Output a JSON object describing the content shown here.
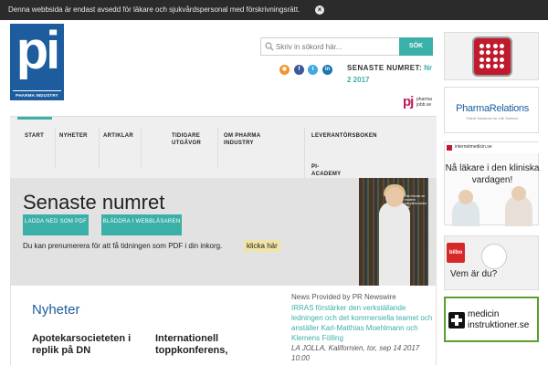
{
  "notice": {
    "text": "Denna webbsida är endast avsedd för läkare och sjukvårdspersonal med förskrivningsrätt.",
    "close": "×"
  },
  "logo": {
    "mark": "pi",
    "subtitle": "PHARMA INDUSTRY"
  },
  "search": {
    "placeholder": "Skriv in sökord här...",
    "button": "SÖK"
  },
  "social": {
    "rss": "◉",
    "facebook": "f",
    "twitter": "t",
    "linkedin": "in"
  },
  "latest_issue": {
    "label": "SENASTE NUMRET:",
    "link": "Nr 2 2017"
  },
  "pharmajobb": {
    "mark": "pj",
    "text_line1": "pharma",
    "text_line2": "jobb.se"
  },
  "nav": {
    "items": [
      "START",
      "NYHETER",
      "ARTIKLAR",
      "TIDIGARE UTGÅVOR",
      "OM PHARMA INDUSTRY",
      "LEVERANTÖRSBOKEN",
      "PI-ACADEMY"
    ]
  },
  "hero": {
    "title": "Senaste numret",
    "download_button": "LADDA NED SOM PDF",
    "browse_button": "BLÄDDRA I WEBBLÄSAREN",
    "subscribe_text": "Du kan prenumerera för att få tidningen som PDF i din inkorg.",
    "subscribe_link": "klicka här"
  },
  "cover": {
    "text": "Hon formar en modern rekrytera andra mål"
  },
  "news": {
    "heading": "Nyheter",
    "item1": "Apotekarsocieteten i replik på DN",
    "item2": "Internationell toppkonferens,"
  },
  "pr": {
    "label": "News Provided by PR Newswire",
    "title": "IRRAS förstärker den verkställande ledningen och det kommersiella teamet och anställer Karl-Matthias Moehlmann och Klemens Fölling",
    "meta": "LA JOLLA, Kalifornien, tor, sep 14 2017 10:00"
  },
  "ads": {
    "pharmarelations_name": "PharmaRelations",
    "pharmarelations_sub": "Talent Solutions for Life Science",
    "internetmedicin_url": "internetmedicin.se",
    "internetmedicin_headline": "Nå läkare i den kliniska vardagen!",
    "bilbo_logo": "bilbo",
    "bilbo_text": "Vem är du?",
    "medicin_text_line1": "medicin",
    "medicin_text_line2": "instruktioner.se"
  },
  "colors": {
    "brand_blue": "#1d5d9e",
    "teal": "#3bb0a8",
    "notice_bg": "#2b2b2b",
    "highlight": "#f0e4a8"
  }
}
